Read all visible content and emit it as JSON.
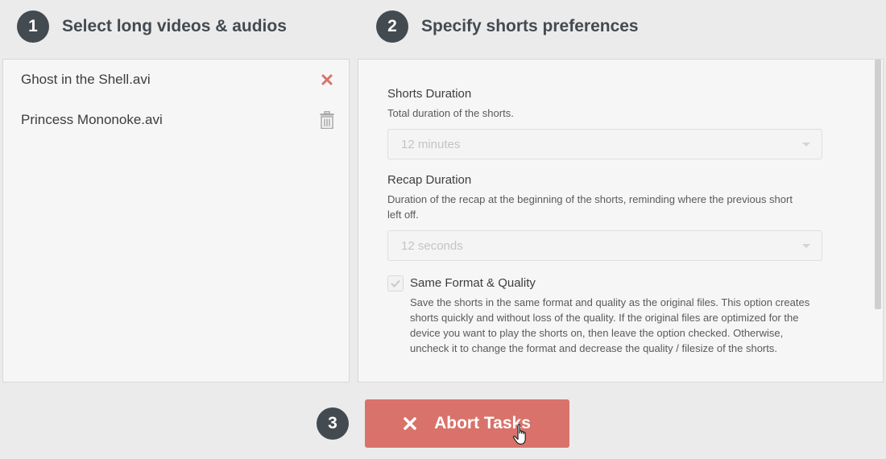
{
  "steps": [
    {
      "number": "1",
      "title": "Select long videos & audios"
    },
    {
      "number": "2",
      "title": "Specify shorts preferences"
    },
    {
      "number": "3"
    }
  ],
  "files": [
    {
      "name": "Ghost in the Shell.avi",
      "action_icon": "close-x-icon",
      "action_color": "#d9726b"
    },
    {
      "name": "Princess Mononoke.avi",
      "action_icon": "trash-icon",
      "action_color": "#a9a9a9"
    }
  ],
  "preferences": {
    "shorts_duration": {
      "label": "Shorts Duration",
      "description": "Total duration of the shorts.",
      "value": "12 minutes"
    },
    "recap_duration": {
      "label": "Recap Duration",
      "description": "Duration of the recap at the beginning of the shorts, reminding where the previous short left off.",
      "value": "12 seconds"
    },
    "same_format": {
      "label": "Same Format & Quality",
      "checked": true,
      "description": "Save the shorts in the same format and quality as the original files. This option creates shorts quickly and without loss of the quality. If the original files are optimized for the device you want to play the shorts on, then leave the option checked. Otherwise, uncheck it to change the format and decrease the quality / filesize of the shorts."
    }
  },
  "abort_button": {
    "label": "Abort Tasks",
    "icon": "close-x-icon"
  },
  "colors": {
    "badge": "#434a50",
    "accent": "#d9726b",
    "panel": "#f6f6f6",
    "background": "#ebebeb"
  }
}
